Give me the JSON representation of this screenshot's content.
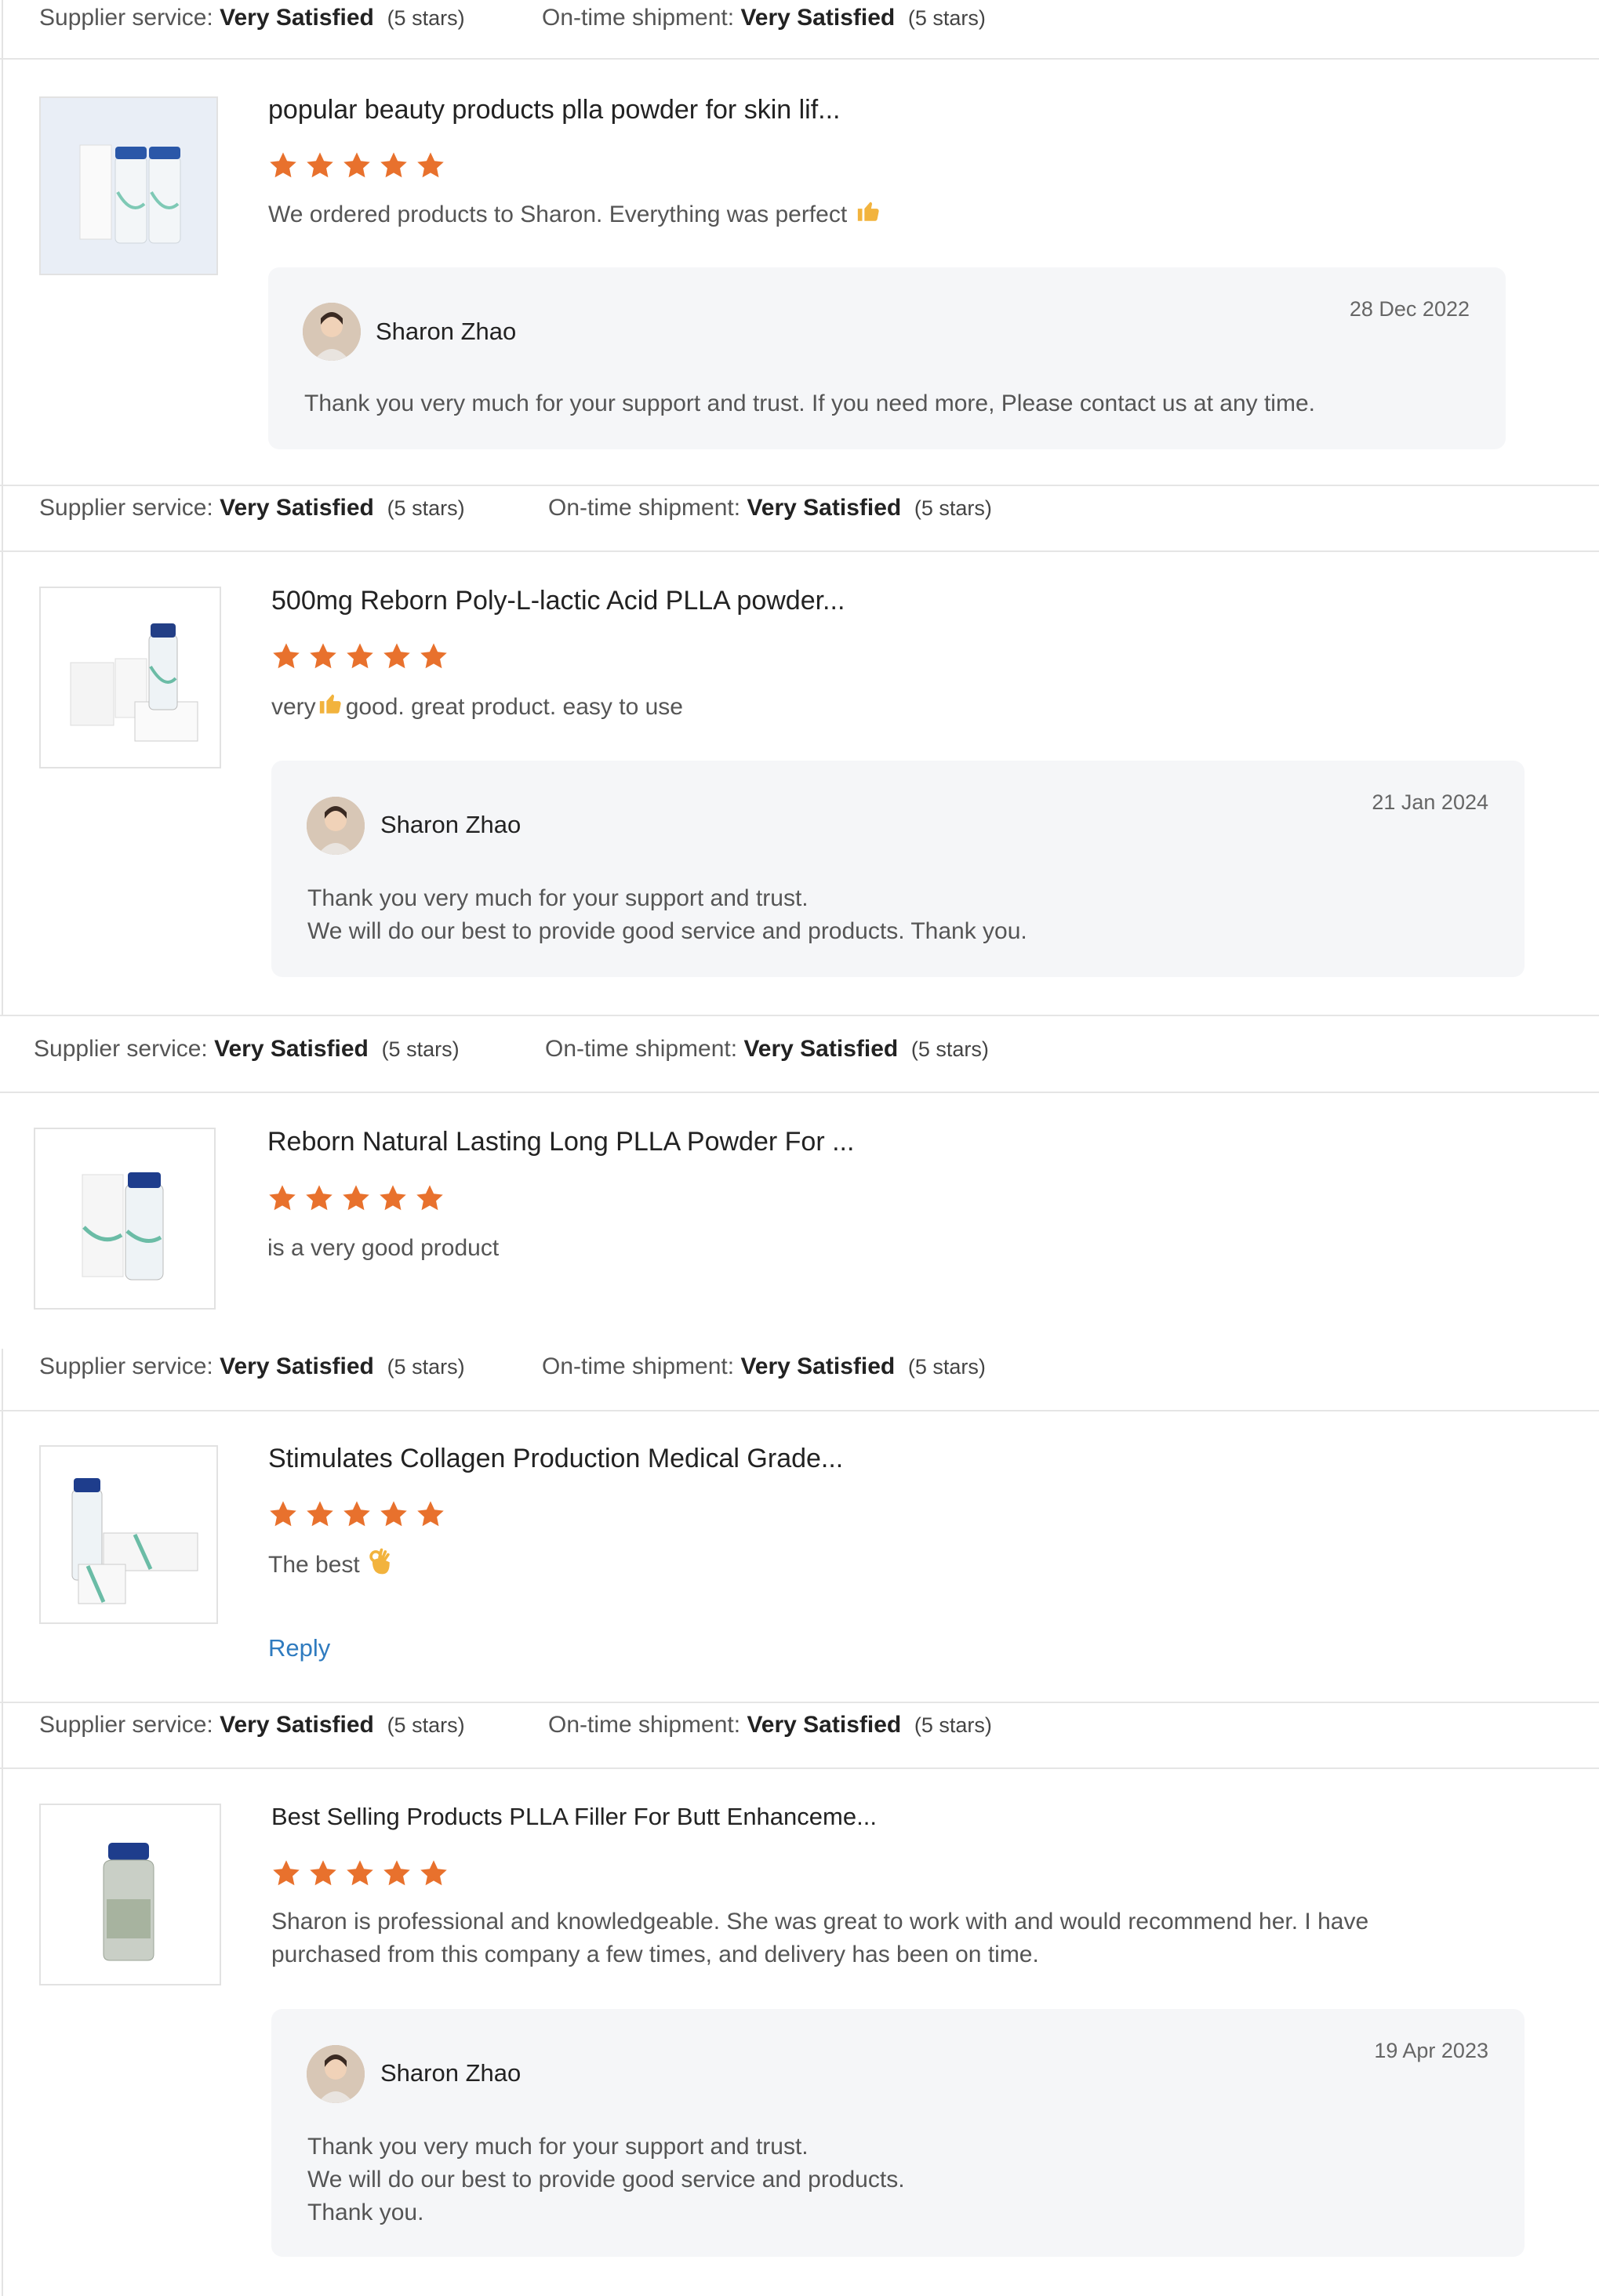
{
  "stat_labels": {
    "supplier": "Supplier service:",
    "shipment": "On-time shipment:",
    "value": "Very Satisfied",
    "count": "(5 stars)"
  },
  "colors": {
    "star": "#e8712d",
    "link": "#2f7bbf"
  },
  "reviews": [
    {
      "title": "popular beauty products plla powder for skin lif...",
      "rating": 5,
      "text": "We ordered products to Sharon. Everything was perfect",
      "text_emoji": "thumbs-up-icon",
      "reply": {
        "name": "Sharon Zhao",
        "date": "28 Dec 2022",
        "lines": [
          "Thank you very much for your support and trust. If you need more, Please contact us at any time."
        ]
      }
    },
    {
      "title": "500mg Reborn Poly-L-lactic Acid PLLA powder...",
      "rating": 5,
      "text_before": "very",
      "text_emoji": "thumbs-up-icon",
      "text": "good. great product. easy to use",
      "reply": {
        "name": "Sharon Zhao",
        "date": "21 Jan 2024",
        "lines": [
          "Thank you very much for your support and trust.",
          "We will do our best to provide good service and products. Thank you."
        ]
      }
    },
    {
      "title": "Reborn Natural Lasting Long PLLA Powder For ...",
      "rating": 5,
      "text": "is a very good product"
    },
    {
      "title": "Stimulates Collagen Production Medical Grade...",
      "rating": 5,
      "text": "The best",
      "text_emoji": "ok-hand-icon",
      "reply_link": "Reply"
    },
    {
      "title": "Best Selling Products PLLA Filler For Butt Enhanceme...",
      "rating": 5,
      "text_lines": [
        "Sharon is professional and knowledgeable.  She was great to work with and would recommend her. I have",
        "purchased from this company a few times, and delivery has been on time."
      ],
      "reply": {
        "name": "Sharon Zhao",
        "date": "19 Apr 2023",
        "lines": [
          "Thank you very much for your support and trust.",
          "We will do our best to provide good service and products.",
          "Thank you."
        ]
      }
    }
  ]
}
